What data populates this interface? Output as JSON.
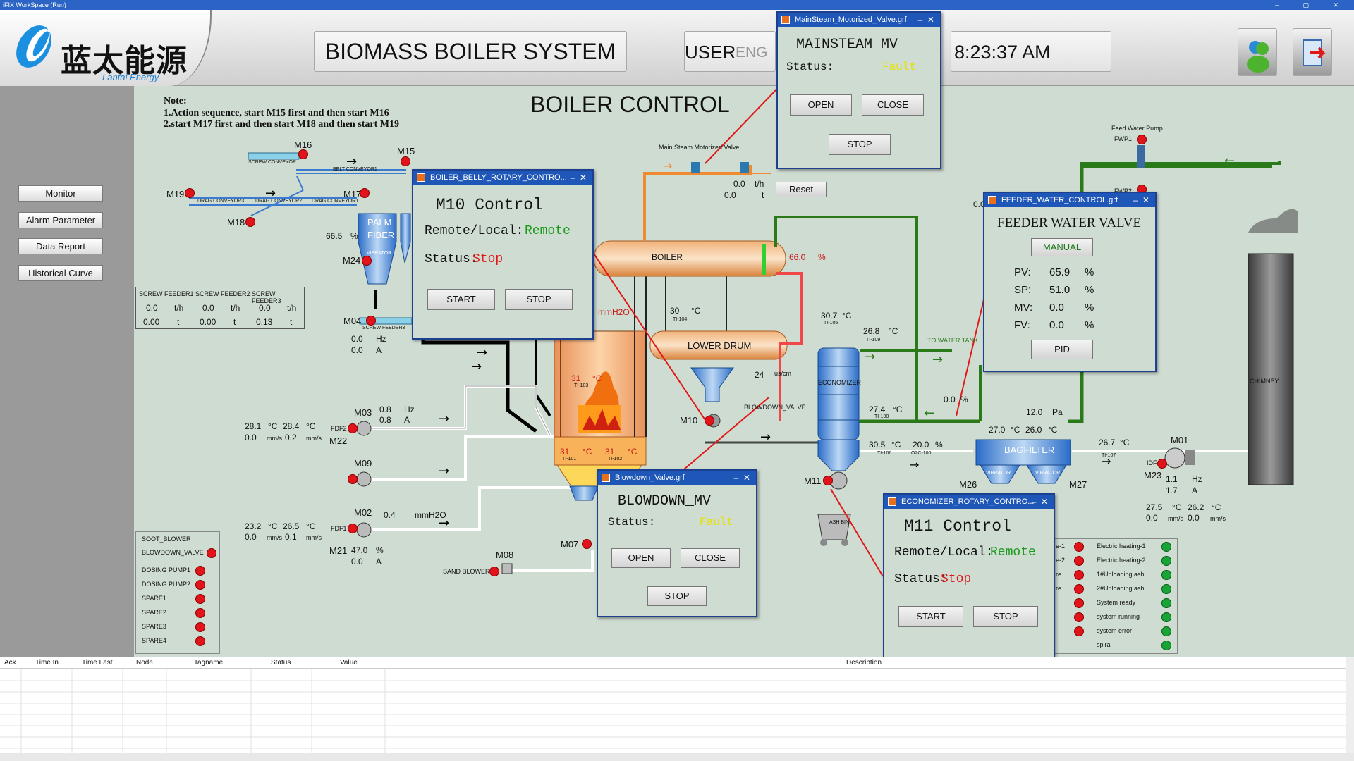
{
  "window_title": "iFIX WorkSpace (Run)",
  "header": {
    "logo_cn": "蓝太能源",
    "logo_en": "Lantai Energy",
    "system_title": "BIOMASS BOILER SYSTEM",
    "user_label": "USER",
    "lang_label": "ENG",
    "clock": "8:23:37 AM"
  },
  "page_title": "BOILER CONTROL",
  "note": {
    "title": "Note:",
    "line1": "1.Action sequence, start M15 first and then start M16",
    "line2": "2.start M17 first and then start M18 and then start M19"
  },
  "nav": [
    "Monitor",
    "Alarm Parameter",
    "Data Report",
    "Historical Curve"
  ],
  "conveyors": {
    "screw_conveyor": "SCREW CONVEYOR",
    "belt_conveyor1": "BELT CONVEYOR1",
    "drag_conveyor3": "DRAG CONVEYOR3",
    "drag_conveyor2": "DRAG CONVEYOR2",
    "drag_conveyor1": "DRAG CONVEYOR1",
    "screw_feeder3": "SCREW FEEDER3"
  },
  "motors": {
    "m16": "M16",
    "m15": "M15",
    "m19": "M19",
    "m17": "M17",
    "m18": "M18",
    "m24": "M24",
    "m04": "M04",
    "m03": "M03",
    "m22": "M22",
    "m09": "M09",
    "m02": "M02",
    "m21": "M21",
    "m08": "M08",
    "m07": "M07",
    "m10": "M10",
    "m11": "M11",
    "m26": "M26",
    "m27": "M27",
    "m01": "M01",
    "m23": "M23"
  },
  "palm_fiber": {
    "label1": "PALM",
    "label2": "FIBER",
    "vibrator": "VIBRATOR",
    "level": "66.5",
    "unit": "%"
  },
  "screw_feeders": {
    "headers": [
      "SCREW FEEDER1",
      "SCREW FEEDER2",
      "SCREW FEEDER3"
    ],
    "flow": [
      "0.0",
      "0.0",
      "0.0"
    ],
    "flow_unit": "t/h",
    "total": [
      "0.00",
      "0.00",
      "0.13"
    ],
    "total_unit": "t"
  },
  "m04_readings": {
    "hz": "0.0",
    "hz_unit": "Hz",
    "a": "0.0",
    "a_unit": "A"
  },
  "m03_readings": {
    "hz": "0.8",
    "hz_unit": "Hz",
    "a": "0.8",
    "a_unit": "A"
  },
  "fdf2": {
    "label": "FDF2",
    "t1": "28.1",
    "t2": "28.4",
    "unit_c": "°C",
    "v1": "0.0",
    "v2": "0.2",
    "unit_v": "mm/s"
  },
  "fdf1": {
    "label": "FDF1",
    "t1": "23.2",
    "t2": "26.5",
    "unit_c": "°C",
    "v1": "0.0",
    "v2": "0.1",
    "unit_v": "mm/s"
  },
  "m02_reading": {
    "value": "0.4",
    "unit": "mmH2O"
  },
  "m21_readings": {
    "pct": "47.0",
    "pct_unit": "%",
    "a": "0.0",
    "a_unit": "A"
  },
  "sand_blower": "SAND BLOWER",
  "furnace": {
    "mmh2o": "mmH2O",
    "ti103_val": "31",
    "ti103_unit": "°C",
    "ti103": "TI-103",
    "ti101_val": "31",
    "ti101_unit": "°C",
    "ti101": "TI-101",
    "ti102_val": "31",
    "ti102_unit": "°C",
    "ti102": "TI-102"
  },
  "boiler": {
    "label": "BOILER",
    "level": "66.0",
    "level_unit": "%",
    "ti104_val": "30",
    "ti104_unit": "°C",
    "ti104": "TI-104",
    "lower_drum": "LOWER DRUM",
    "blowdown_rate": "24",
    "blowdown_unit": "us/cm",
    "blowdown_valve": "BLOWDOWN_VALVE"
  },
  "main_steam": {
    "label": "Main Steam Motorized Valve",
    "flow": "0.0",
    "flow_unit": "t/h",
    "total": "0.0",
    "total_unit": "t",
    "reset": "Reset"
  },
  "economizer": {
    "label": "ECONOMIZER",
    "ti105_val": "30.7",
    "ti105_unit": "°C",
    "ti105": "TI-105",
    "ti109_val": "26.8",
    "ti109_unit": "°C",
    "ti109": "TI-109",
    "ti108_val": "27.4",
    "ti108_unit": "°C",
    "ti108": "TI-108",
    "ti106_val": "30.5",
    "ti106_unit": "°C",
    "ti106": "TI-106",
    "o2_val": "20.0",
    "o2_unit": "%",
    "o2": "O2C-100",
    "to_water_tank": "TO WATER TANK",
    "valve_pct": "0.0",
    "valve_unit": "%",
    "ash_bin": "ASH BIN"
  },
  "bagfilter": {
    "label": "BAGFILTER",
    "dp": "12.0",
    "dp_unit": "Pa",
    "t1": "27.0",
    "t2": "26.0",
    "t_unit": "°C",
    "vibrator": "VIBRATOR"
  },
  "idf": {
    "ti107_val": "26.7",
    "ti107_unit": "°C",
    "ti107": "TI-107",
    "label": "IDF",
    "hz": "1.1",
    "hz_unit": "Hz",
    "a": "1.7",
    "a_unit": "A",
    "t1": "27.5",
    "t2": "26.2",
    "unit_c": "°C",
    "v1": "0.0",
    "v2": "0.0",
    "unit_v": "mm/s"
  },
  "chimney": "CHIMNEY",
  "feed_water_pump": {
    "label": "Feed Water Pump",
    "fwp1": "FWP1",
    "fwp2": "FWP2",
    "partial": "0.0"
  },
  "left_status": {
    "title": "SOOT_BLOWER",
    "items": [
      "BLOWDOWN_VALVE",
      "DOSING PUMP1",
      "DOSING PUMP2",
      "SPARE1",
      "SPARE2",
      "SPARE3",
      "SPARE4"
    ]
  },
  "right_status": {
    "left_partials": [
      "e-1",
      "e-2",
      "re",
      "re"
    ],
    "items": [
      "Electric heating-1",
      "Electric heating-2",
      "1#Unloading ash",
      "2#Unloading ash",
      "System ready",
      "system running",
      "system error",
      "spiral"
    ]
  },
  "popups": {
    "mainsteam": {
      "title": "MainSteam_Motorized_Valve.grf",
      "heading": "MAINSTEAM_MV",
      "status_label": "Status:",
      "status": "Fault",
      "open": "OPEN",
      "close": "CLOSE",
      "stop": "STOP"
    },
    "m10": {
      "title": "BOILER_BELLY_ROTARY_CONTRO...",
      "heading": "M10 Control",
      "mode_label": "Remote/Local:",
      "mode": "Remote",
      "status_label": "Status:",
      "status": "Stop",
      "start": "START",
      "stop": "STOP"
    },
    "feeder": {
      "title": "FEEDER_WATER_CONTROL.grf",
      "heading": "FEEDER WATER VALVE",
      "manual": "MANUAL",
      "pv_label": "PV:",
      "pv": "65.9",
      "sp_label": "SP:",
      "sp": "51.0",
      "mv_label": "MV:",
      "mv": "0.0",
      "fv_label": "FV:",
      "fv": "0.0",
      "unit": "%",
      "pid": "PID"
    },
    "blowdown": {
      "title": "Blowdown_Valve.grf",
      "heading": "BLOWDOWN_MV",
      "status_label": "Status:",
      "status": "Fault",
      "open": "OPEN",
      "close": "CLOSE",
      "stop": "STOP"
    },
    "m11": {
      "title": "ECONOMIZER_ROTARY_CONTRO...",
      "heading": "M11 Control",
      "mode_label": "Remote/Local:",
      "mode": "Remote",
      "status_label": "Status:",
      "status": "Stop",
      "start": "START",
      "stop": "STOP"
    }
  },
  "alarm_table": {
    "columns": [
      "Ack",
      "Time In",
      "Time Last",
      "Node",
      "Tagname",
      "Status",
      "Value",
      "Description"
    ]
  },
  "colors": {
    "fault": "#e8e000",
    "remote": "#1a9a1a",
    "stop": "#e01818",
    "led_red": "#e0141a",
    "led_green": "#19a535",
    "title_blue": "#1f57b8"
  }
}
